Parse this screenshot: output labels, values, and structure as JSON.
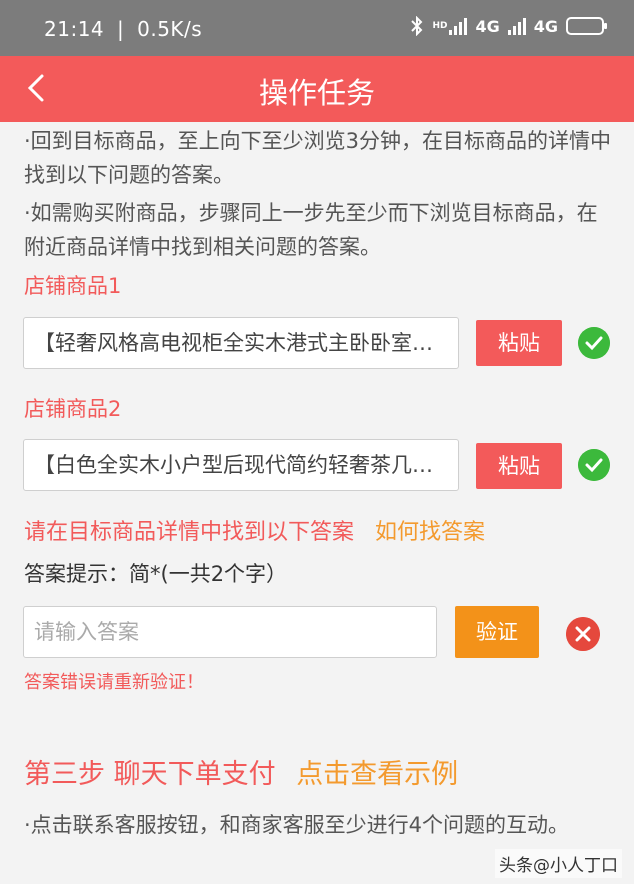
{
  "status_bar": {
    "time": "21:14",
    "speed": "0.5K/s",
    "network1": "4G",
    "network2": "4G",
    "hd": "HD"
  },
  "nav": {
    "title": "操作任务"
  },
  "instructions": {
    "line1": "·回到目标商品，至上向下至少浏览3分钟，在目标商品的详情中找到以下问题的答案。",
    "line2": "·如需购买附商品，步骤同上一步先至少而下浏览目标商品，在附近商品详情中找到相关问题的答案。"
  },
  "products": [
    {
      "label": "店铺商品1",
      "value": "【轻奢风格高电视柜全实木港式主卧卧室简约",
      "paste": "粘贴"
    },
    {
      "label": "店铺商品2",
      "value": "【白色全实木小户型后现代简约轻奢茶几组合",
      "paste": "粘贴"
    }
  ],
  "answer": {
    "prompt": "请在目标商品详情中找到以下答案",
    "how_to": "如何找答案",
    "hint": "答案提示：简*(一共2个字）",
    "placeholder": "请输入答案",
    "verify": "验证",
    "error": "答案错误请重新验证！"
  },
  "step3": {
    "title": "第三步 聊天下单支付",
    "example": "点击查看示例",
    "desc": "·点击联系客服按钮，和商家客服至少进行4个问题的互动。"
  },
  "watermark": "头条@小人丁口",
  "colors": {
    "primary": "#f35a5a",
    "orange": "#f39219",
    "success": "#3cb93c",
    "error": "#e5483d"
  }
}
